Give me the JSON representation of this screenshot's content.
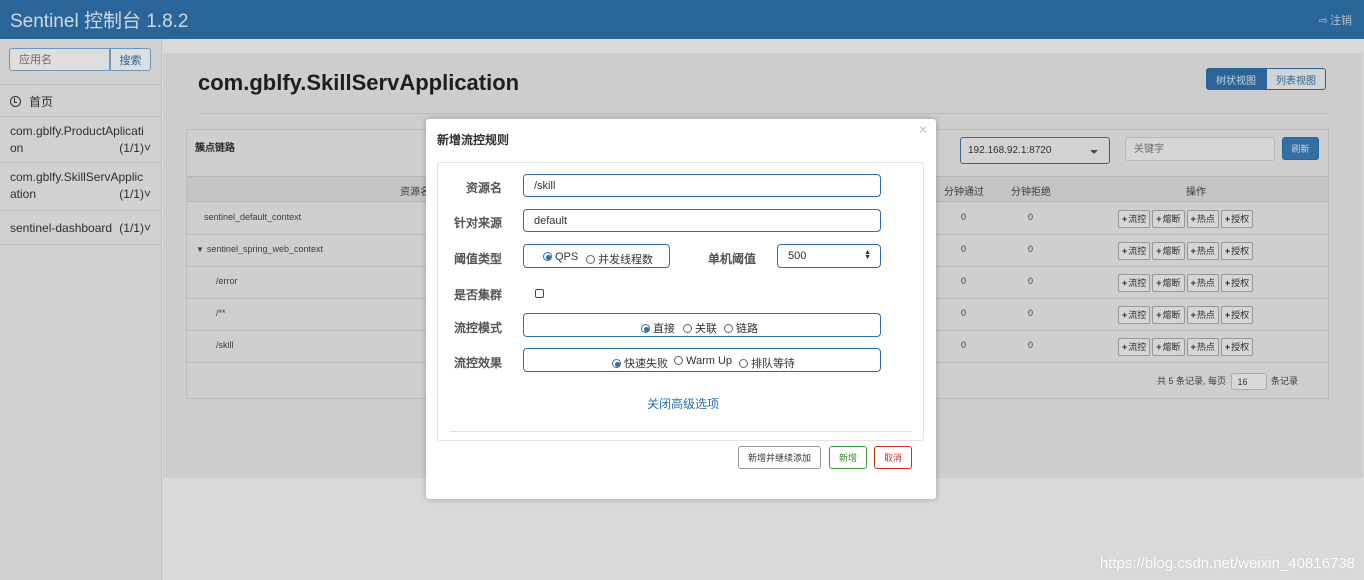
{
  "header": {
    "brand": "Sentinel 控制台 1.8.2",
    "logout_label": "注销",
    "logout_icon": "sign-out-icon"
  },
  "sidebar": {
    "search_placeholder": "应用名",
    "search_button": "搜索",
    "home_label": "首页",
    "apps": [
      {
        "line1": "com.gblfy.ProductAplicati",
        "line2": "on",
        "count": "(1/1)"
      },
      {
        "line1": "com.gblfy.SkillServApplic",
        "line2": "ation",
        "count": "(1/1)"
      },
      {
        "line1": "sentinel-dashboard",
        "line2": "",
        "count": "(1/1)"
      }
    ]
  },
  "main": {
    "title": "com.gblfy.SkillServApplication",
    "view_tabs": [
      "树状视图",
      "列表视图"
    ],
    "card_title": "簇点链路",
    "machine_select": "192.168.92.1:8720",
    "keyword_placeholder": "关键字",
    "refresh_button": "刷新",
    "columns": [
      "资源名",
      "分钟通过",
      "分钟拒绝",
      "操作"
    ],
    "rows": [
      {
        "name": "sentinel_default_context",
        "pass": "0",
        "block": "0"
      },
      {
        "name": "sentinel_spring_web_context",
        "pass": "0",
        "block": "0"
      },
      {
        "name": "/error",
        "pass": "0",
        "block": "0"
      },
      {
        "name": "/**",
        "pass": "0",
        "block": "0"
      },
      {
        "name": "/skill",
        "pass": "0",
        "block": "0"
      }
    ],
    "op_buttons": [
      "流控",
      "熔断",
      "热点",
      "授权"
    ],
    "pager": {
      "prefix": "共 5 条记录, 每页",
      "size": "16",
      "suffix": "条记录"
    }
  },
  "modal": {
    "title": "新增流控规则",
    "close_symbol": "×",
    "resource_label": "资源名",
    "resource_value": "/skill",
    "origin_label": "针对来源",
    "origin_value": "default",
    "threshold_type_label": "阈值类型",
    "threshold_type_options": [
      "QPS",
      "并发线程数"
    ],
    "threshold_type_selected": "QPS",
    "single_threshold_label": "单机阈值",
    "single_threshold_value": "500",
    "cluster_label": "是否集群",
    "cluster_checked": false,
    "mode_label": "流控模式",
    "mode_options": [
      "直接",
      "关联",
      "链路"
    ],
    "mode_selected": "直接",
    "effect_label": "流控效果",
    "effect_options": [
      "快速失败",
      "Warm Up",
      "排队等待"
    ],
    "effect_selected": "快速失败",
    "advanced_link": "关闭高级选项",
    "buttons": {
      "add_continue": "新增并继续添加",
      "add": "新增",
      "cancel": "取消"
    }
  },
  "watermark": "https://blog.csdn.net/weixin_40816738",
  "colors": {
    "brand": "#2e6fa8",
    "add": "#2d8a2d",
    "cancel": "#c9302c"
  }
}
